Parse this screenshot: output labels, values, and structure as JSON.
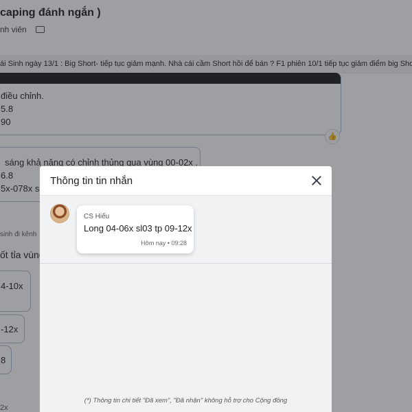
{
  "background": {
    "title": "caping đánh ngắn )",
    "subtitle": "nh viên",
    "banner": "ái Sinh ngày 13/1 : Big Short- tiếp tục giảm mạnh. Nhà cái cầm Short hồi để bán ?  F1 phiên 10/1 tiếp tục giảm điểm big Short",
    "bubble1_lines": [
      "điều chỉnh.",
      "5.8",
      "90"
    ],
    "bubble2_lines": [
      "sáng khả năng có chỉnh thủng qua vùng 00-02x .",
      "6.8",
      "5x-078x sl"
    ],
    "side_label": "sinh đi kênh",
    "side_text": "ốt tỉa vùng",
    "bubble3_text": "4-10x",
    "bubble4_text": "-12x",
    "bubble5_text": "8",
    "bottom_text": "2x"
  },
  "modal": {
    "title": "Thông tin tin nhắn",
    "message": {
      "sender": "CS Hiếu",
      "text": "Long 04-06x sl03 tp 09-12x",
      "time": "Hôm nay • 09:28"
    },
    "footnote": "(*) Thông tin chi tiết \"Đã xem\", \"Đã nhận\" không hỗ trợ cho Cộng đồng"
  }
}
